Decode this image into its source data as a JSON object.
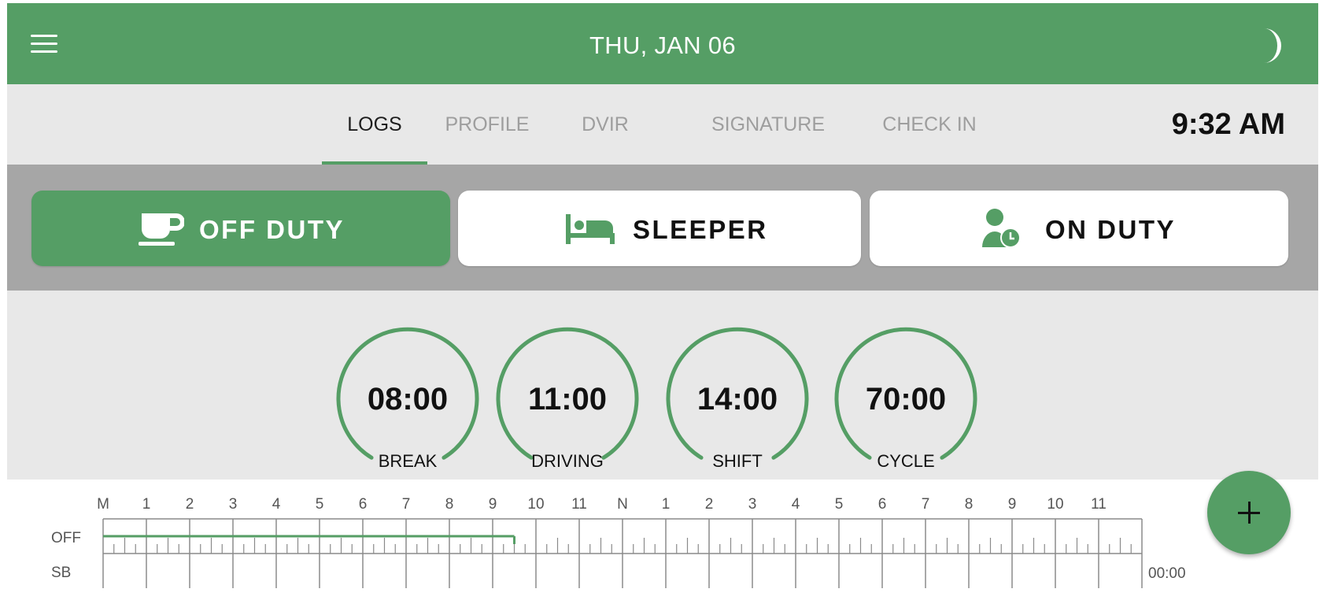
{
  "header": {
    "title": "THU, JAN 06",
    "menu_icon": "hamburger-menu-icon",
    "theme_icon": "moon-icon"
  },
  "tabs": [
    {
      "label": "LOGS",
      "active": true
    },
    {
      "label": "PROFILE",
      "active": false
    },
    {
      "label": "DVIR",
      "active": false
    },
    {
      "label": "SIGNATURE",
      "active": false
    },
    {
      "label": "CHECK IN",
      "active": false
    }
  ],
  "clock": "9:32 AM",
  "status_buttons": [
    {
      "label": "OFF DUTY",
      "icon": "coffee-cup-icon",
      "active": true
    },
    {
      "label": "SLEEPER",
      "icon": "bed-icon",
      "active": false
    },
    {
      "label": "ON DUTY",
      "icon": "person-clock-icon",
      "active": false
    }
  ],
  "gauges": [
    {
      "value": "08:00",
      "label": "BREAK"
    },
    {
      "value": "11:00",
      "label": "DRIVING"
    },
    {
      "value": "14:00",
      "label": "SHIFT"
    },
    {
      "value": "70:00",
      "label": "CYCLE"
    }
  ],
  "log_grid": {
    "hour_labels": [
      "M",
      "1",
      "2",
      "3",
      "4",
      "5",
      "6",
      "7",
      "8",
      "9",
      "10",
      "11",
      "N",
      "1",
      "2",
      "3",
      "4",
      "5",
      "6",
      "7",
      "8",
      "9",
      "10",
      "11"
    ],
    "row_labels": [
      "OFF",
      "SB"
    ],
    "off_duty_until_hour": 9.5,
    "partial_total": "00:00"
  },
  "fab": {
    "icon": "plus-icon"
  },
  "colors": {
    "accent": "#559e65",
    "band": "#a6a6a6",
    "background": "#e8e8e8"
  }
}
